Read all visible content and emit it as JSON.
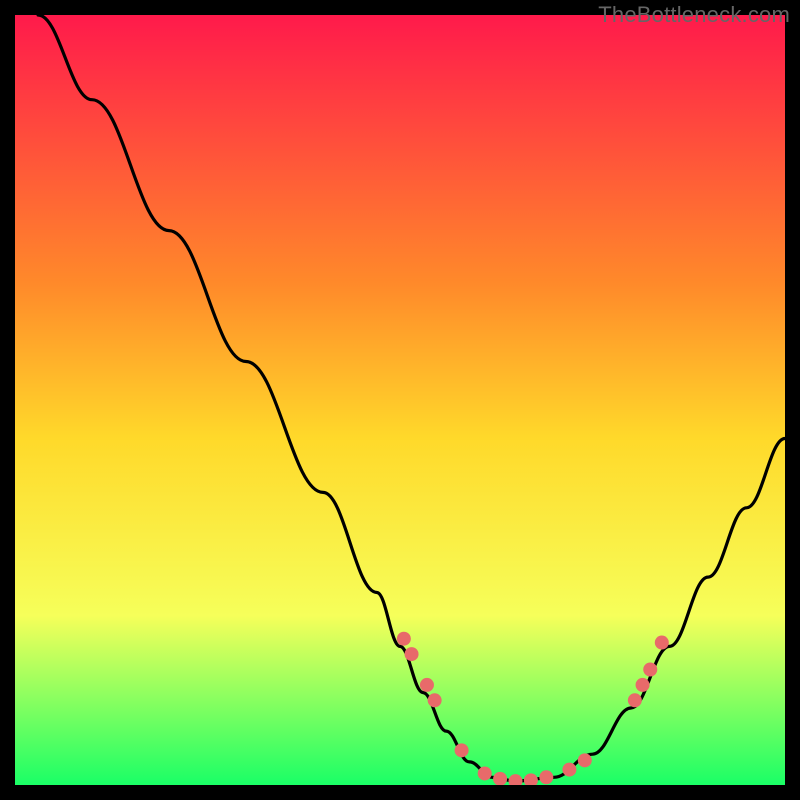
{
  "watermark": "TheBottleneck.com",
  "colors": {
    "gradient_top": "#ff1a4b",
    "gradient_mid1": "#ff8a2a",
    "gradient_mid2": "#ffd92a",
    "gradient_mid3": "#f6ff5a",
    "gradient_bottom": "#1aff66",
    "curve": "#000000",
    "dot": "#e86a6a",
    "frame": "#000000"
  },
  "chart_data": {
    "type": "line",
    "title": "",
    "xlabel": "",
    "ylabel": "",
    "xlim": [
      0,
      100
    ],
    "ylim": [
      0,
      100
    ],
    "grid": false,
    "legend": false,
    "series": [
      {
        "name": "curve",
        "x": [
          3,
          10,
          20,
          30,
          40,
          47,
          50,
          53,
          56,
          59,
          62,
          65,
          70,
          75,
          80,
          85,
          90,
          95,
          100
        ],
        "y": [
          100,
          89,
          72,
          55,
          38,
          25,
          18,
          12,
          7,
          3,
          1,
          0.5,
          1,
          4,
          10,
          18,
          27,
          36,
          45
        ]
      }
    ],
    "dots": {
      "name": "highlight-points",
      "x": [
        50.5,
        51.5,
        53.5,
        54.5,
        58,
        61,
        63,
        65,
        67,
        69,
        72,
        74,
        80.5,
        81.5,
        82.5,
        84
      ],
      "y": [
        19,
        17,
        13,
        11,
        4.5,
        1.5,
        0.8,
        0.5,
        0.6,
        1.0,
        2.0,
        3.2,
        11,
        13,
        15,
        18.5
      ]
    }
  }
}
